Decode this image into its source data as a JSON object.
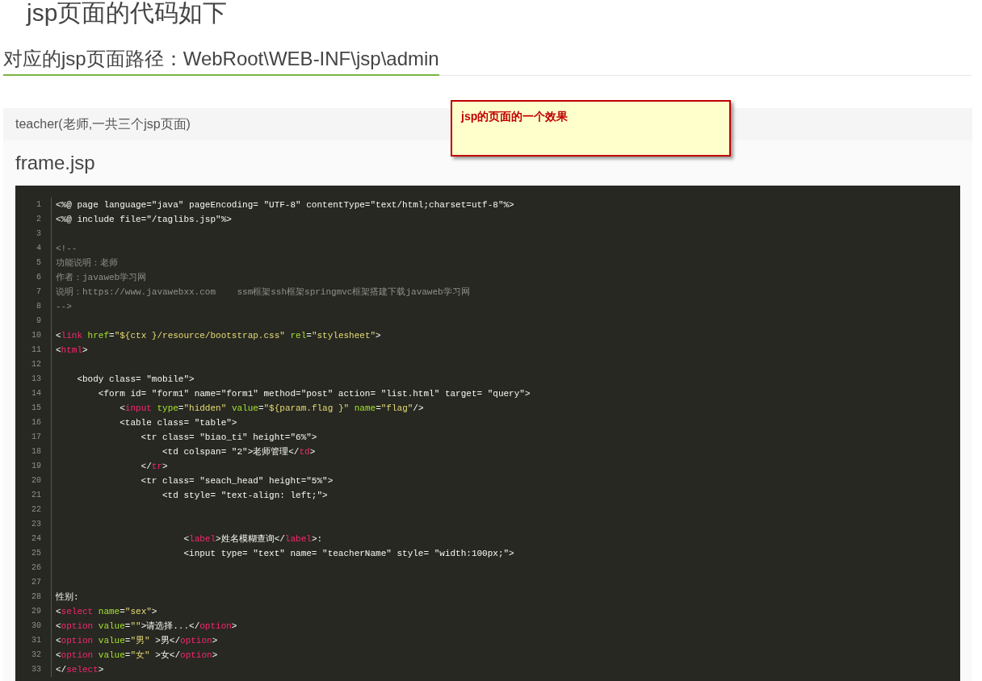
{
  "heading": "jsp页面的代码如下",
  "path_heading": "对应的jsp页面路径：WebRoot\\WEB-INF\\jsp\\admin",
  "note": {
    "text": "jsp的页面的一个效果"
  },
  "panel": {
    "title": "teacher(老师,一共三个jsp页面)",
    "file_title": "frame.jsp"
  },
  "code": [
    {
      "number": "1",
      "segments": [
        {
          "kind": "plain",
          "t": "<%@ page language=\"java\" pageEncoding= \"UTF-8\" contentType=\"text/html;charset=utf-8\"%>"
        }
      ]
    },
    {
      "number": "2",
      "segments": [
        {
          "kind": "plain",
          "t": "<%@ include file=\"/taglibs.jsp\"%>"
        }
      ]
    },
    {
      "number": "3"
    },
    {
      "number": "4",
      "segments": [
        {
          "kind": "comment",
          "t": "<!--"
        }
      ]
    },
    {
      "number": "5",
      "segments": [
        {
          "kind": "comment",
          "t": "功能说明：老师"
        }
      ]
    },
    {
      "number": "6",
      "segments": [
        {
          "kind": "comment",
          "t": "作者：javaweb学习网"
        }
      ]
    },
    {
      "number": "7",
      "segments": [
        {
          "kind": "comment",
          "t": "说明：https://www.javawebxx.com    ssm框架ssh框架springmvc框架搭建下载javaweb学习网"
        }
      ]
    },
    {
      "number": "8",
      "segments": [
        {
          "kind": "comment",
          "t": "-->"
        }
      ]
    },
    {
      "number": "9"
    },
    {
      "number": "10",
      "segments": [
        {
          "kind": "plain",
          "t": "<"
        },
        {
          "kind": "tag",
          "t": "link"
        },
        {
          "kind": "attr",
          "t": " href"
        },
        {
          "kind": "plain",
          "t": "="
        },
        {
          "kind": "str",
          "t": "\"${ctx }/resource/bootstrap.css\""
        },
        {
          "kind": "attr",
          "t": " rel"
        },
        {
          "kind": "plain",
          "t": "="
        },
        {
          "kind": "str",
          "t": "\"stylesheet\""
        },
        {
          "kind": "plain",
          "t": ">"
        }
      ]
    },
    {
      "number": "11",
      "segments": [
        {
          "kind": "plain",
          "t": "<"
        },
        {
          "kind": "tag",
          "t": "html"
        },
        {
          "kind": "plain",
          "t": ">"
        }
      ]
    },
    {
      "number": "12"
    },
    {
      "number": "13",
      "segments": [
        {
          "kind": "plain",
          "t": "    <body class= \"mobile\">"
        }
      ]
    },
    {
      "number": "14",
      "segments": [
        {
          "kind": "plain",
          "t": "        <form id= \"form1\" name=\"form1\" method=\"post\" action= \"list.html\" target= \"query\">"
        }
      ]
    },
    {
      "number": "15",
      "segments": [
        {
          "kind": "plain",
          "t": "            <"
        },
        {
          "kind": "tag",
          "t": "input"
        },
        {
          "kind": "attr",
          "t": " type"
        },
        {
          "kind": "plain",
          "t": "="
        },
        {
          "kind": "str",
          "t": "\"hidden\""
        },
        {
          "kind": "attr",
          "t": " value"
        },
        {
          "kind": "plain",
          "t": "="
        },
        {
          "kind": "str",
          "t": "\"${param.flag }\""
        },
        {
          "kind": "attr",
          "t": " name"
        },
        {
          "kind": "plain",
          "t": "="
        },
        {
          "kind": "str",
          "t": "\"flag\""
        },
        {
          "kind": "plain",
          "t": "/>"
        }
      ]
    },
    {
      "number": "16",
      "segments": [
        {
          "kind": "plain",
          "t": "            <table class= \"table\">"
        }
      ]
    },
    {
      "number": "17",
      "segments": [
        {
          "kind": "plain",
          "t": "                <tr class= \"biao_ti\" height=\"6%\">"
        }
      ]
    },
    {
      "number": "18",
      "segments": [
        {
          "kind": "plain",
          "t": "                    <td colspan= \"2\">老师管理</"
        },
        {
          "kind": "tag",
          "t": "td"
        },
        {
          "kind": "plain",
          "t": ">"
        }
      ]
    },
    {
      "number": "19",
      "segments": [
        {
          "kind": "plain",
          "t": "                </"
        },
        {
          "kind": "tag",
          "t": "tr"
        },
        {
          "kind": "plain",
          "t": ">"
        }
      ]
    },
    {
      "number": "20",
      "segments": [
        {
          "kind": "plain",
          "t": "                <tr class= \"seach_head\" height=\"5%\">"
        }
      ]
    },
    {
      "number": "21",
      "segments": [
        {
          "kind": "plain",
          "t": "                    <td style= \"text-align: left;\">"
        }
      ]
    },
    {
      "number": "22"
    },
    {
      "number": "23"
    },
    {
      "number": "24",
      "segments": [
        {
          "kind": "plain",
          "t": "                        <"
        },
        {
          "kind": "tag",
          "t": "label"
        },
        {
          "kind": "plain",
          "t": ">姓名模糊查询</"
        },
        {
          "kind": "tag",
          "t": "label"
        },
        {
          "kind": "plain",
          "t": ">:"
        }
      ]
    },
    {
      "number": "25",
      "segments": [
        {
          "kind": "plain",
          "t": "                        <input type= \"text\" name= \"teacherName\" style= \"width:100px;\">"
        }
      ]
    },
    {
      "number": "26"
    },
    {
      "number": "27"
    },
    {
      "number": "28",
      "segments": [
        {
          "kind": "plain",
          "t": "性别:"
        }
      ]
    },
    {
      "number": "29",
      "segments": [
        {
          "kind": "plain",
          "t": "<"
        },
        {
          "kind": "tag",
          "t": "select"
        },
        {
          "kind": "attr",
          "t": " name"
        },
        {
          "kind": "plain",
          "t": "="
        },
        {
          "kind": "str",
          "t": "\"sex\""
        },
        {
          "kind": "plain",
          "t": ">"
        }
      ]
    },
    {
      "number": "30",
      "segments": [
        {
          "kind": "plain",
          "t": "<"
        },
        {
          "kind": "tag",
          "t": "option"
        },
        {
          "kind": "attr",
          "t": " value"
        },
        {
          "kind": "plain",
          "t": "="
        },
        {
          "kind": "str",
          "t": "\"\""
        },
        {
          "kind": "plain",
          "t": ">请选择...</"
        },
        {
          "kind": "tag",
          "t": "option"
        },
        {
          "kind": "plain",
          "t": ">"
        }
      ]
    },
    {
      "number": "31",
      "segments": [
        {
          "kind": "plain",
          "t": "<"
        },
        {
          "kind": "tag",
          "t": "option"
        },
        {
          "kind": "attr",
          "t": " value"
        },
        {
          "kind": "plain",
          "t": "="
        },
        {
          "kind": "str",
          "t": "\"男\""
        },
        {
          "kind": "plain",
          "t": " >男</"
        },
        {
          "kind": "tag",
          "t": "option"
        },
        {
          "kind": "plain",
          "t": ">"
        }
      ]
    },
    {
      "number": "32",
      "segments": [
        {
          "kind": "plain",
          "t": "<"
        },
        {
          "kind": "tag",
          "t": "option"
        },
        {
          "kind": "attr",
          "t": " value"
        },
        {
          "kind": "plain",
          "t": "="
        },
        {
          "kind": "str",
          "t": "\"女\""
        },
        {
          "kind": "plain",
          "t": " >女</"
        },
        {
          "kind": "tag",
          "t": "option"
        },
        {
          "kind": "plain",
          "t": ">"
        }
      ]
    },
    {
      "number": "33",
      "segments": [
        {
          "kind": "plain",
          "t": "</"
        },
        {
          "kind": "tag",
          "t": "select"
        },
        {
          "kind": "plain",
          "t": ">"
        }
      ]
    }
  ]
}
